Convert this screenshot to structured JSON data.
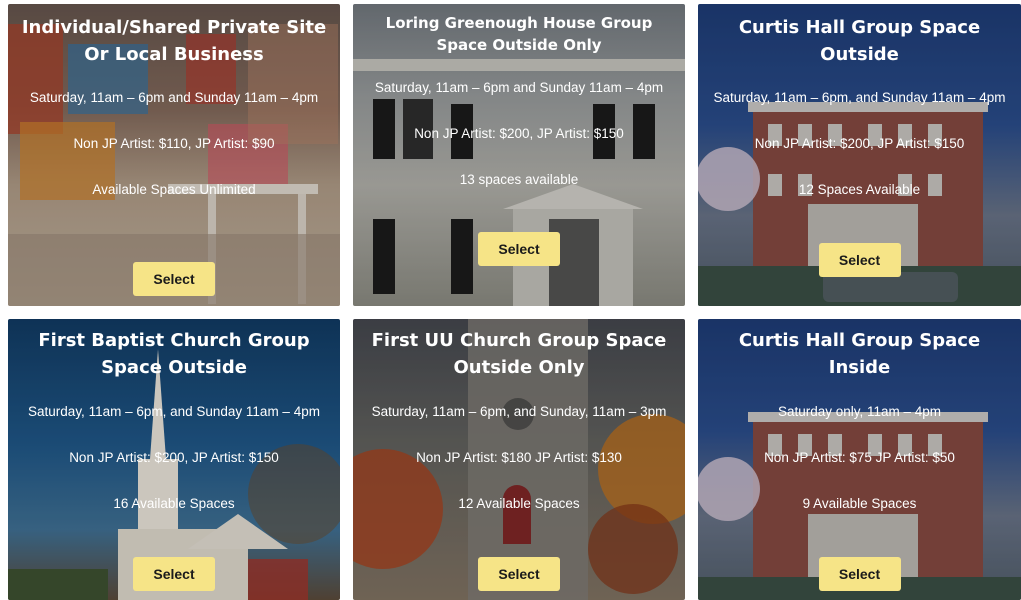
{
  "select_label": "Select",
  "colors": {
    "button_bg": "#f6e487",
    "button_text": "#1b1b1b",
    "text": "#ffffff"
  },
  "cards": [
    {
      "title": "Individual/Shared Private Site Or Local Business",
      "schedule": "Saturday, 11am – 6pm and Sunday 11am – 4pm",
      "price": "Non JP Artist: $110, JP Artist: $90",
      "availability": "Available Spaces Unlimited"
    },
    {
      "title": "Loring Greenough House Group Space Outside Only",
      "schedule": "Saturday, 11am – 6pm and Sunday 11am – 4pm",
      "price": "Non JP Artist: $200, JP Artist: $150",
      "availability": "13 spaces available"
    },
    {
      "title": "Curtis Hall Group Space Outside",
      "schedule": "Saturday, 11am – 6pm, and Sunday 11am – 4pm",
      "price": "Non JP Artist: $200, JP Artist: $150",
      "availability": "12 Spaces Available"
    },
    {
      "title": "First Baptist Church Group Space Outside",
      "schedule": "Saturday, 11am – 6pm, and Sunday 11am – 4pm",
      "price": "Non JP Artist: $200, JP Artist: $150",
      "availability": "16 Available Spaces"
    },
    {
      "title": "First UU Church Group Space Outside Only",
      "schedule": "Saturday, 11am – 6pm, and Sunday, 11am – 3pm",
      "price": "Non JP Artist: $180 JP Artist: $130",
      "availability": "12 Available Spaces"
    },
    {
      "title": "Curtis Hall Group Space Inside",
      "schedule": "Saturday only, 11am – 4pm",
      "price": "Non JP Artist: $75 JP Artist: $50",
      "availability": "9 Available Spaces"
    }
  ]
}
